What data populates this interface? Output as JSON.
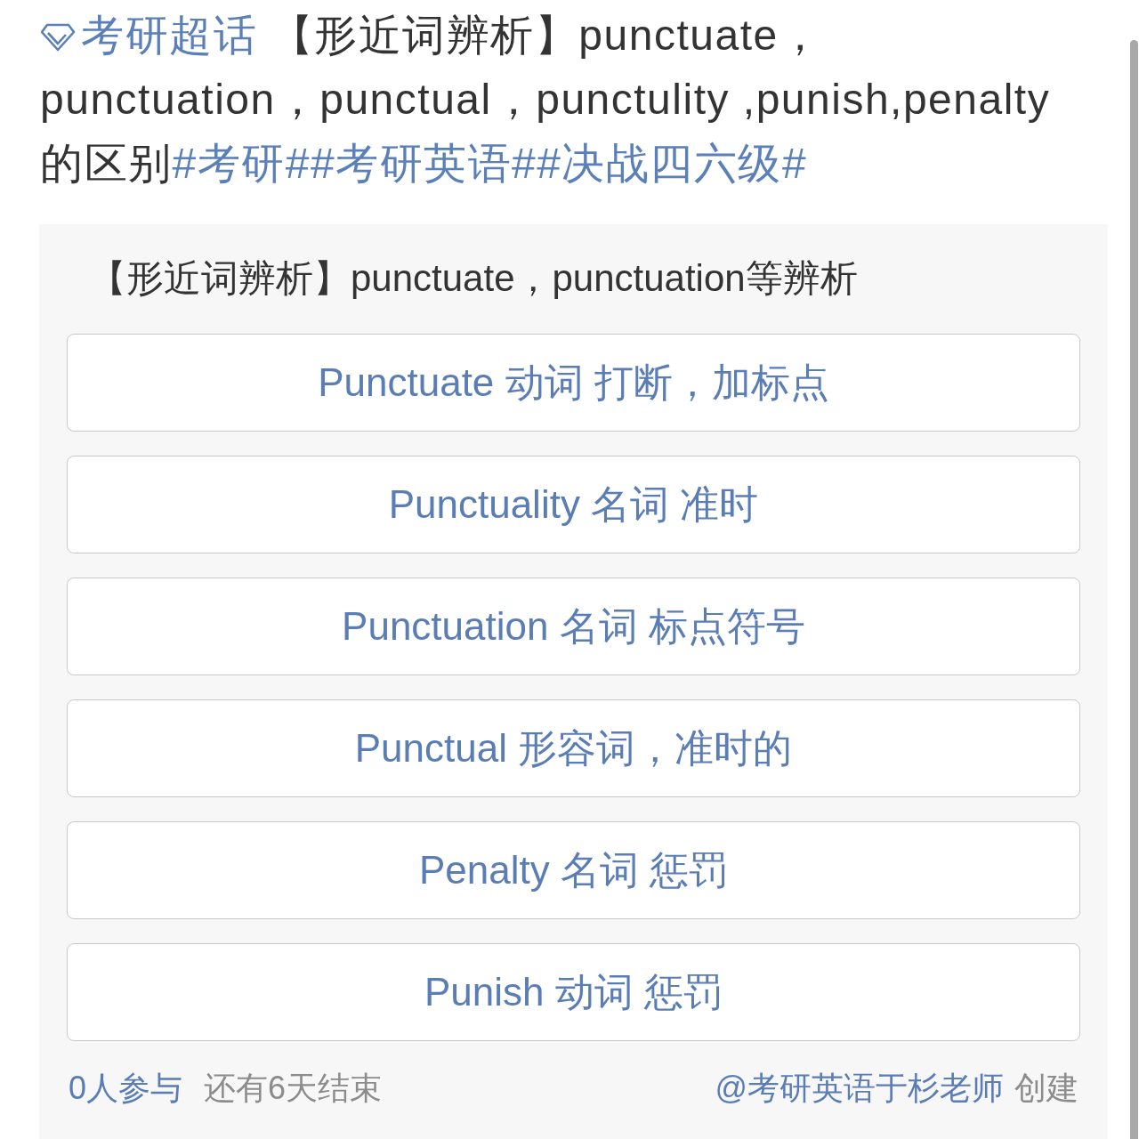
{
  "post": {
    "supertopic": "考研超话",
    "text": " 【形近词辨析】punctuate，punctuation，punctual，punctulity ,punish,penalty的区别",
    "hashtags": [
      "#考研#",
      "#考研英语#",
      "#决战四六级#"
    ]
  },
  "poll": {
    "title": "【形近词辨析】punctuate，punctuation等辨析",
    "options": [
      "Punctuate 动词 打断，加标点",
      "Punctuality 名词 准时",
      "Punctuation 名词 标点符号",
      "Punctual 形容词，准时的",
      "Penalty 名词 惩罚",
      "Punish 动词 惩罚"
    ],
    "participants": "0人参与",
    "time_left": "还有6天结束",
    "creator": "@考研英语于杉老师",
    "created_label": "创建"
  }
}
